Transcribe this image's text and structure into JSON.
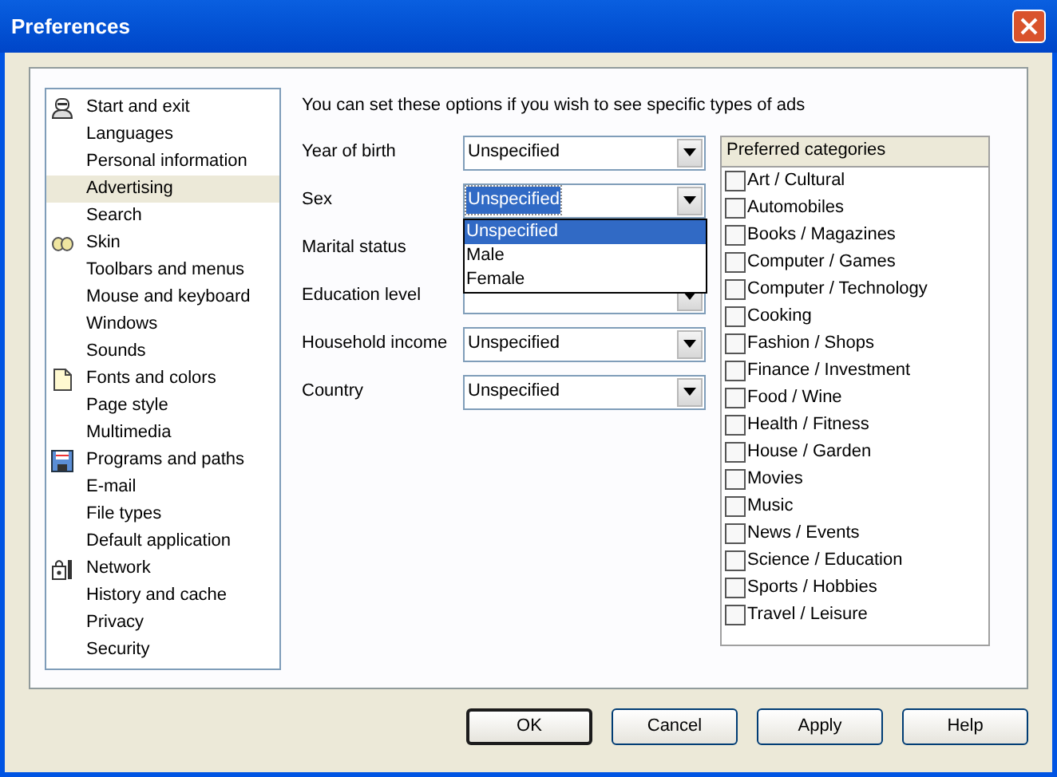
{
  "window": {
    "title": "Preferences"
  },
  "sidebar": {
    "items": [
      {
        "label": "Start and exit",
        "kind": "person",
        "selected": false
      },
      {
        "label": "Languages",
        "selected": false
      },
      {
        "label": "Personal information",
        "selected": false
      },
      {
        "label": "Advertising",
        "selected": true
      },
      {
        "label": "Search",
        "selected": false
      },
      {
        "label": "Skin",
        "kind": "glasses",
        "selected": false
      },
      {
        "label": "Toolbars and menus",
        "selected": false
      },
      {
        "label": "Mouse and keyboard",
        "selected": false
      },
      {
        "label": "Windows",
        "selected": false
      },
      {
        "label": "Sounds",
        "selected": false
      },
      {
        "label": "Fonts and colors",
        "kind": "page",
        "selected": false
      },
      {
        "label": "Page style",
        "selected": false
      },
      {
        "label": "Multimedia",
        "selected": false
      },
      {
        "label": "Programs and paths",
        "kind": "disk",
        "selected": false
      },
      {
        "label": "E-mail",
        "selected": false
      },
      {
        "label": "File types",
        "selected": false
      },
      {
        "label": "Default application",
        "selected": false
      },
      {
        "label": "Network",
        "kind": "lock",
        "selected": false
      },
      {
        "label": "History and cache",
        "selected": false
      },
      {
        "label": "Privacy",
        "selected": false
      },
      {
        "label": "Security",
        "selected": false
      }
    ]
  },
  "intro": "You can set these options if you wish to see specific types of ads",
  "fields": [
    {
      "label": "Year of birth",
      "kind": "combo",
      "value": "Unspecified",
      "focused": false
    },
    {
      "label": "Sex",
      "kind": "combo",
      "value": "Unspecified",
      "focused": true,
      "dropdown": {
        "options": [
          {
            "label": "Unspecified",
            "selected": true
          },
          {
            "label": "Male",
            "selected": false
          },
          {
            "label": "Female",
            "selected": false
          }
        ]
      }
    },
    {
      "label": "Marital status",
      "kind": "hidden"
    },
    {
      "label": "Education level",
      "kind": "combo"
    },
    {
      "label": "Household income",
      "kind": "combo",
      "value": "Unspecified",
      "focused": false
    },
    {
      "label": "Country",
      "kind": "combo",
      "value": "Unspecified",
      "focused": false
    }
  ],
  "categories": {
    "title": "Preferred categories",
    "items": [
      {
        "label": "Art / Cultural",
        "checked": false
      },
      {
        "label": "Automobiles",
        "checked": false
      },
      {
        "label": "Books / Magazines",
        "checked": false
      },
      {
        "label": "Computer / Games",
        "checked": false
      },
      {
        "label": "Computer / Technology",
        "checked": false
      },
      {
        "label": "Cooking",
        "checked": false
      },
      {
        "label": "Fashion / Shops",
        "checked": false
      },
      {
        "label": "Finance / Investment",
        "checked": false
      },
      {
        "label": "Food / Wine",
        "checked": false
      },
      {
        "label": "Health / Fitness",
        "checked": false
      },
      {
        "label": "House / Garden",
        "checked": false
      },
      {
        "label": "Movies",
        "checked": false
      },
      {
        "label": "Music",
        "checked": false
      },
      {
        "label": "News / Events",
        "checked": false
      },
      {
        "label": "Science / Education",
        "checked": false
      },
      {
        "label": "Sports / Hobbies",
        "checked": false
      },
      {
        "label": "Travel / Leisure",
        "checked": false
      }
    ]
  },
  "buttons": [
    {
      "label": "OK",
      "default": true
    },
    {
      "label": "Cancel",
      "default": false
    },
    {
      "label": "Apply",
      "default": false
    },
    {
      "label": "Help",
      "default": false
    }
  ]
}
